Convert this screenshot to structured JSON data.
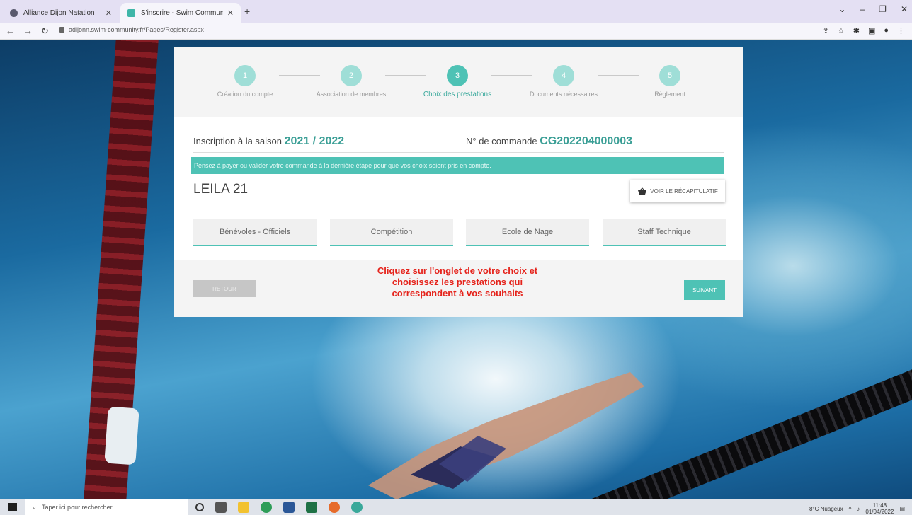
{
  "browser": {
    "tabs": [
      {
        "title": "Alliance Dijon Natation",
        "active": false
      },
      {
        "title": "S'inscrire - Swim Community",
        "active": true
      }
    ],
    "new_tab": "+",
    "url": "adijonn.swim-community.fr/Pages/Register.aspx"
  },
  "steps": [
    {
      "num": "1",
      "label": "Création du compte"
    },
    {
      "num": "2",
      "label": "Association de membres"
    },
    {
      "num": "3",
      "label": "Choix des prestations"
    },
    {
      "num": "4",
      "label": "Documents nécessaires"
    },
    {
      "num": "5",
      "label": "Règlement"
    }
  ],
  "season": {
    "label": "Inscription à la saison",
    "value": "2021 / 2022"
  },
  "order": {
    "label": "N° de commande",
    "value": "CG202204000003"
  },
  "notice": "Pensez à payer ou valider votre commande à la dernière étape pour que vos choix soient pris en compte.",
  "member_name": "LEILA 21",
  "recap_button": "VOIR LE RÉCAPITULATIF",
  "categories": [
    "Bénévoles - Officiels",
    "Compétition",
    "Ecole de Nage",
    "Staff Technique"
  ],
  "back_button": "RETOUR",
  "next_button": "SUIVANT",
  "instruction": "Cliquez sur l'onglet de votre choix et\nchoisissez les prestations qui\ncorrespondent  à vos souhaits",
  "taskbar": {
    "search_placeholder": "Taper ici pour rechercher",
    "weather": "8°C Nuageux",
    "time": "11:48",
    "date": "01/04/2022"
  },
  "colors": {
    "accent": "#4ec2b5",
    "instruction": "#e5231b"
  }
}
